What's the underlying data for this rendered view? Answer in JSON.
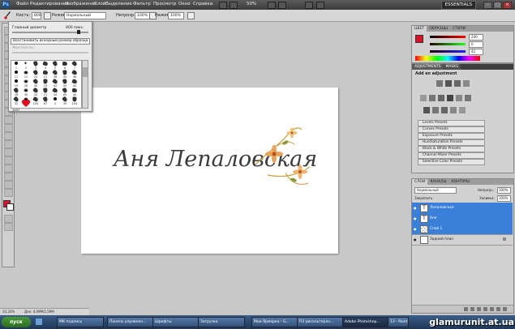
{
  "menu": {
    "items": [
      "Файл",
      "Редактирование",
      "Изображение",
      "Слой",
      "Выделение",
      "Фильтр",
      "Просмотр",
      "Окно",
      "Справка"
    ],
    "zoom": "50%",
    "workspace": "ESSENTIALS"
  },
  "options": {
    "brush_label": "Кисть:",
    "brush_size": "800",
    "mode_label": "Режим:",
    "mode_value": "Нормальный",
    "opacity_label": "Непрозр.:",
    "opacity_value": "100%",
    "flow_label": "Нажим:",
    "flow_value": "100%"
  },
  "brush_panel": {
    "diameter_label": "Главный диаметр",
    "diameter_value": "800 пикс.",
    "restore_button": "Восстановить исходный размер образца",
    "hardness_label": "Жесткость:",
    "footer_value": "1957",
    "brushes": [
      {
        "n": "1",
        "shape": "dot"
      },
      {
        "n": "2",
        "shape": "star"
      },
      {
        "n": "3",
        "shape": "blot"
      },
      {
        "n": "4",
        "shape": "blot"
      },
      {
        "n": "5",
        "shape": "blot"
      },
      {
        "n": "6",
        "shape": "blot"
      },
      {
        "n": "7",
        "shape": "blot"
      },
      {
        "n": "11",
        "shape": "dot"
      },
      {
        "n": "12",
        "shape": "round"
      },
      {
        "n": "24",
        "shape": "blot"
      },
      {
        "n": "21",
        "shape": "blot"
      },
      {
        "n": "38",
        "shape": "blot"
      },
      {
        "n": "44",
        "shape": "blot"
      },
      {
        "n": "46",
        "shape": "blot"
      },
      {
        "n": "19",
        "shape": "dot"
      },
      {
        "n": "28",
        "shape": "round"
      },
      {
        "n": "40",
        "shape": "blot"
      },
      {
        "n": "14",
        "shape": "blot"
      },
      {
        "n": "42",
        "shape": "blot"
      },
      {
        "n": "40",
        "shape": "blot"
      },
      {
        "n": "40",
        "shape": "blot"
      },
      {
        "n": "16",
        "shape": "blot"
      },
      {
        "n": "30",
        "shape": "round"
      },
      {
        "n": "20",
        "shape": "blot"
      },
      {
        "n": "21",
        "shape": "blot"
      },
      {
        "n": "44",
        "shape": "blot"
      },
      {
        "n": "60",
        "shape": "blot"
      },
      {
        "n": "40",
        "shape": "blot"
      },
      {
        "n": "32",
        "shape": "blot"
      },
      {
        "n": "55",
        "shape": "round"
      },
      {
        "n": "100",
        "shape": "blot"
      },
      {
        "n": "67",
        "shape": "blot"
      },
      {
        "n": "3",
        "shape": "dot"
      },
      {
        "n": "39",
        "shape": "blot"
      },
      {
        "n": "104",
        "shape": "blot"
      }
    ]
  },
  "document": {
    "text": "Аня Лепаловская"
  },
  "color_panel": {
    "tabs": [
      "ЦВЕТ",
      "ОБРАЗЦЫ",
      "СТИЛИ"
    ],
    "r": "240",
    "g": "0",
    "b": "42",
    "fg_color": "#e0102a"
  },
  "adjustments": {
    "tabs": [
      "ADJUSTMENTS",
      "MASKS"
    ],
    "heading": "Add an adjustment",
    "presets": [
      "Levels Presets",
      "Curves Presets",
      "Exposure Presets",
      "Hue/Saturation Presets",
      "Black & White Presets",
      "Channel Mixer Presets",
      "Selective Color Presets"
    ]
  },
  "layers": {
    "tabs": [
      "СЛОИ",
      "КАНАЛЫ",
      "КОНТУРЫ"
    ],
    "blend_mode": "Нормальный",
    "opacity_label": "Непрозр.:",
    "opacity_value": "100%",
    "lock_label": "Закрепить:",
    "fill_label": "Заливка:",
    "fill_value": "100%",
    "items": [
      {
        "name": "Лепаловская",
        "thumb": "T",
        "selected": true
      },
      {
        "name": "Аня",
        "thumb": "T",
        "selected": true
      },
      {
        "name": "Слой 1",
        "thumb": "",
        "selected": true
      },
      {
        "name": "Задний план",
        "thumb": "",
        "selected": false
      }
    ]
  },
  "status": {
    "zoom": "33,33%",
    "doc_size": "Док: 4,49М/2,59М"
  },
  "taskbar": {
    "start": "пуск",
    "tasks": [
      "МК подпись",
      "Панель управлен...",
      "Шрифты",
      "Загрузка",
      "Мои Ярмарка - G...",
      "ПЗ рисольтерзн...",
      "Adobe Photoshop...",
      "13 - Paint"
    ],
    "active": 6
  },
  "watermark": "glamurunit.at.ua"
}
